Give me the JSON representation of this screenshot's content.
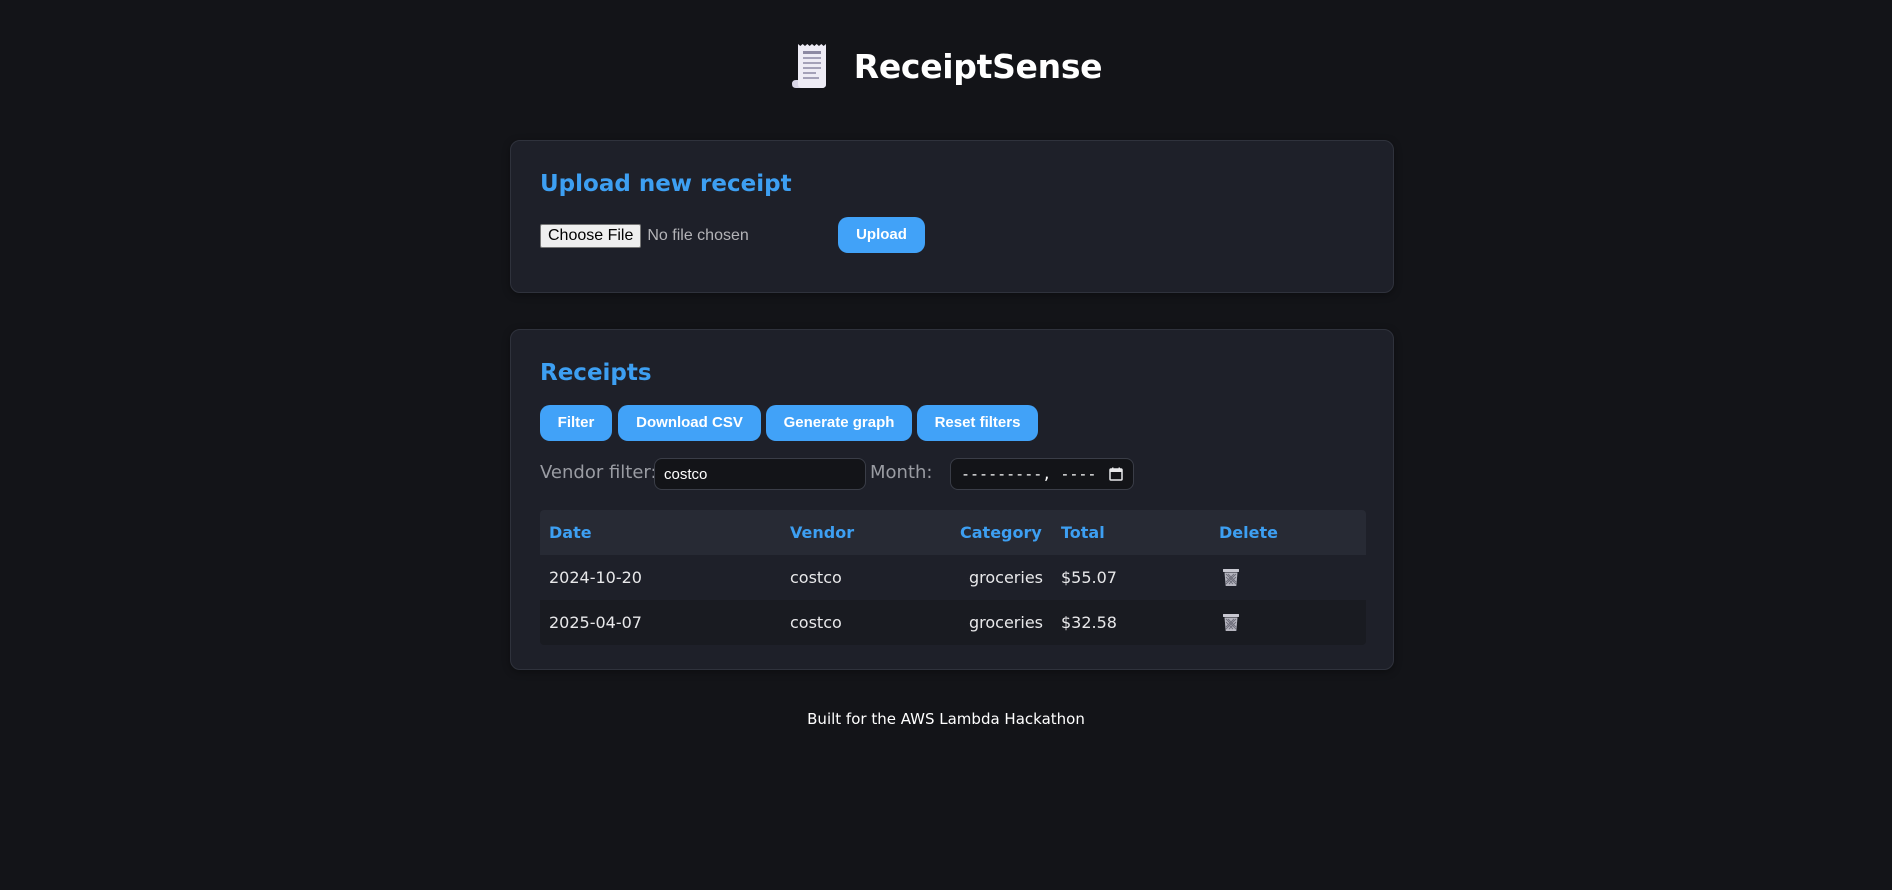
{
  "app": {
    "title": "ReceiptSense",
    "logo_icon": "receipt-icon"
  },
  "upload": {
    "heading": "Upload new receipt",
    "choose_file_label": "Choose File",
    "file_status": "No file chosen",
    "upload_label": "Upload"
  },
  "receipts": {
    "heading": "Receipts",
    "actions": {
      "filter": "Filter",
      "download_csv": "Download CSV",
      "generate_graph": "Generate graph",
      "reset_filters": "Reset filters"
    },
    "filters": {
      "vendor_label": "Vendor filter:",
      "vendor_value": "costco",
      "month_label": "Month:",
      "month_placeholder": "---------, ----"
    },
    "table": {
      "columns": [
        "Date",
        "Vendor",
        "Category",
        "Total",
        "Delete"
      ],
      "rows": [
        {
          "date": "2024-10-20",
          "vendor": "costco",
          "category": "groceries",
          "total": "$55.07",
          "delete_icon": "trash-icon"
        },
        {
          "date": "2025-04-07",
          "vendor": "costco",
          "category": "groceries",
          "total": "$32.58",
          "delete_icon": "trash-icon"
        }
      ]
    }
  },
  "footer": {
    "text": "Built for the AWS Lambda Hackathon"
  },
  "colors": {
    "background": "#131418",
    "card": "#1e2029",
    "accent": "#41a2f8",
    "heading": "#3d9ff2"
  }
}
